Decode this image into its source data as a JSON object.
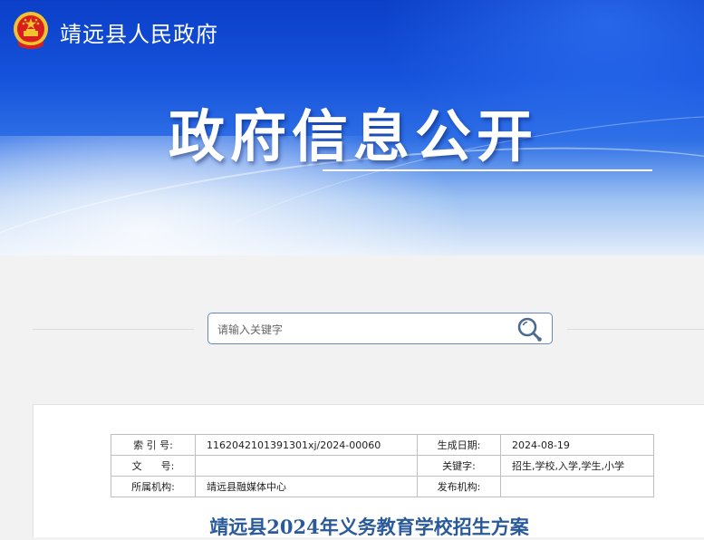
{
  "header": {
    "site_name": "靖远县人民政府",
    "banner_title": "政府信息公开",
    "emblem_icon": "national-emblem-icon"
  },
  "search": {
    "placeholder": "请输入关键字",
    "icon": "search-icon"
  },
  "meta_table": {
    "index_label": "索 引 号:",
    "index_value": "1162042101391301xj/2024-00060",
    "date_label": "生成日期:",
    "date_value": "2024-08-19",
    "doc_no_label": "文      号:",
    "doc_no_value": "",
    "keywords_label": "关键字:",
    "keywords_value": "招生,学校,入学,学生,小学",
    "org_label": "所属机构:",
    "org_value": "靖远县融媒体中心",
    "publisher_label": "发布机构:",
    "publisher_value": ""
  },
  "article": {
    "title": "靖远县2024年义务教育学校招生方案"
  },
  "colors": {
    "banner_blue": "#1552db",
    "title_blue": "#2a5a9a",
    "emblem_red": "#d81e1e",
    "emblem_gold": "#f2c230"
  }
}
